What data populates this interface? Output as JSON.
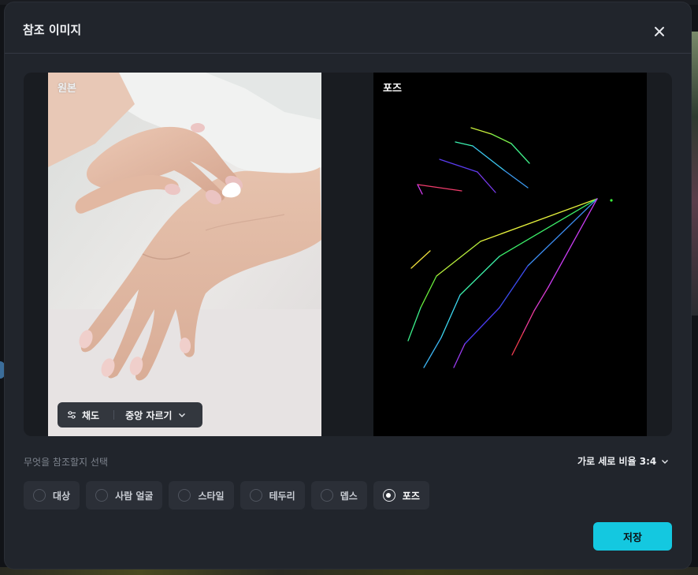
{
  "dialog": {
    "title": "참조 이미지",
    "close_icon": "close-icon"
  },
  "preview": {
    "original_label": "원본",
    "pose_label": "포즈",
    "saturation_label": "채도",
    "crop_mode": "중앙 자르기"
  },
  "reference": {
    "prompt": "무엇을 참조할지 선택",
    "aspect_ratio_label": "가로 세로 비율 3:4",
    "options": [
      {
        "label": "대상",
        "selected": false
      },
      {
        "label": "사람 얼굴",
        "selected": false
      },
      {
        "label": "스타일",
        "selected": false
      },
      {
        "label": "테두리",
        "selected": false
      },
      {
        "label": "뎁스",
        "selected": false
      },
      {
        "label": "포즈",
        "selected": true
      }
    ]
  },
  "footer": {
    "save_label": "저장"
  },
  "colors": {
    "accent": "#14c8e0",
    "dialog_bg": "#21252c",
    "chip_bg": "#2b2f37"
  }
}
